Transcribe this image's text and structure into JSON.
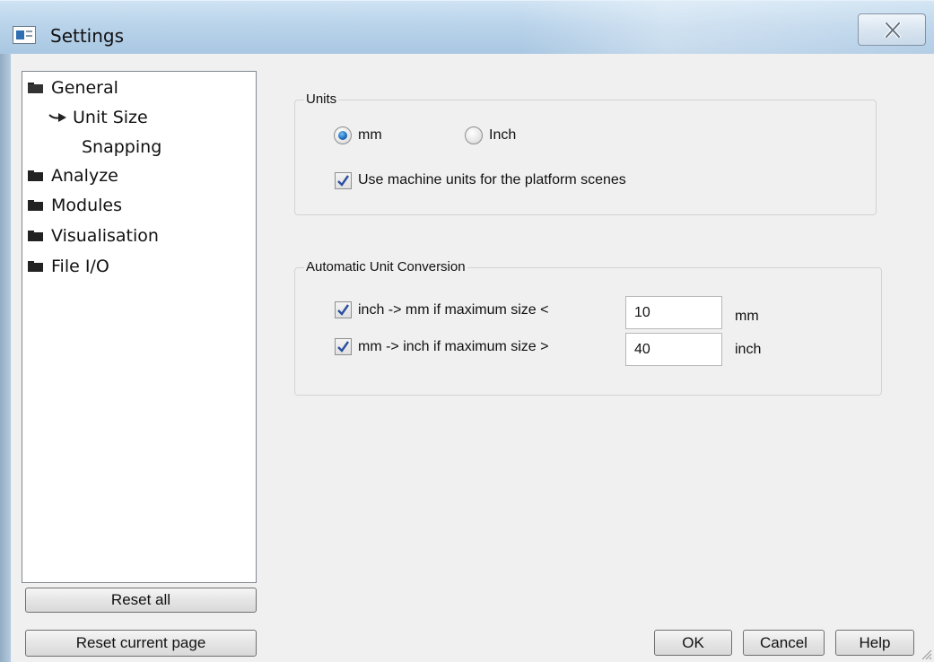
{
  "window": {
    "title": "Settings"
  },
  "tree": {
    "items": [
      {
        "label": "General"
      },
      {
        "label": "Unit Size"
      },
      {
        "label": "Snapping"
      },
      {
        "label": "Analyze"
      },
      {
        "label": "Modules"
      },
      {
        "label": "Visualisation"
      },
      {
        "label": "File I/O"
      }
    ]
  },
  "buttons": {
    "reset_all": "Reset all",
    "reset_current": "Reset current page",
    "ok": "OK",
    "cancel": "Cancel",
    "help": "Help"
  },
  "units": {
    "legend": "Units",
    "mm_label": "mm",
    "inch_label": "Inch",
    "selected": "mm",
    "machine_units_label": "Use machine units for the platform scenes",
    "machine_units_checked": true
  },
  "conversion": {
    "legend": "Automatic Unit Conversion",
    "inch_to_mm_label": "inch -> mm if maximum size <",
    "inch_to_mm_value": "10",
    "inch_to_mm_unit": "mm",
    "inch_to_mm_checked": true,
    "mm_to_inch_label": "mm -> inch if maximum size >",
    "mm_to_inch_value": "40",
    "mm_to_inch_unit": "inch",
    "mm_to_inch_checked": true
  },
  "icons": {
    "app": "app-window-icon",
    "close": "close-icon",
    "folder": "folder-icon",
    "arrow": "arrow-right-icon"
  }
}
